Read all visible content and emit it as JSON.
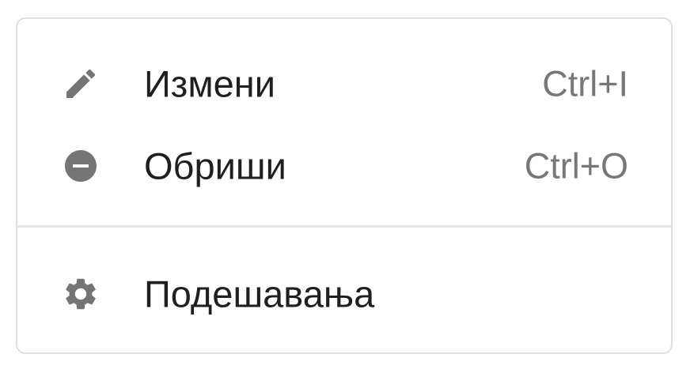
{
  "menu": {
    "items": [
      {
        "label": "Измени",
        "shortcut": "Ctrl+I",
        "icon": "pencil-icon"
      },
      {
        "label": "Обриши",
        "shortcut": "Ctrl+O",
        "icon": "minus-circle-icon"
      }
    ],
    "secondary_items": [
      {
        "label": "Подешавања",
        "icon": "gear-icon"
      }
    ]
  },
  "colors": {
    "icon": "#757575",
    "label": "#1f1f1f",
    "shortcut": "#777777",
    "border": "#dedede",
    "divider": "#e6e6e6"
  }
}
